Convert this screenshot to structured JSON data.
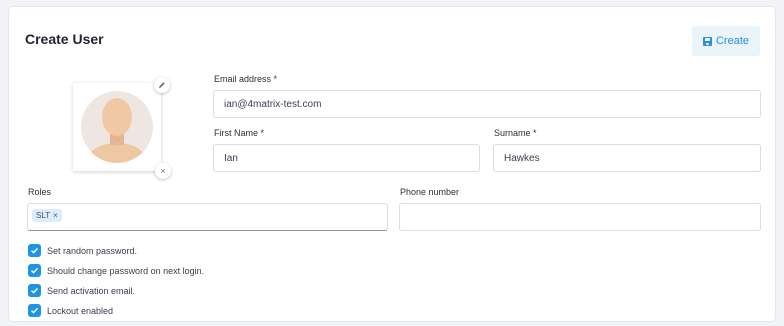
{
  "form": {
    "title": "Create User",
    "create_label": "Create",
    "email": {
      "label": "Email address *",
      "value": "ian@4matrix-test.com"
    },
    "first_name": {
      "label": "First Name *",
      "value": "Ian"
    },
    "surname": {
      "label": "Surname *",
      "value": "Hawkes"
    },
    "roles": {
      "label": "Roles",
      "chips": [
        {
          "label": "SLT",
          "remove": "×"
        }
      ]
    },
    "phone": {
      "label": "Phone number",
      "value": ""
    },
    "avatar": {
      "edit_icon": "pencil-icon",
      "remove_glyph": "×"
    },
    "options": [
      {
        "label": "Set random password.",
        "checked": true
      },
      {
        "label": "Should change password on next login.",
        "checked": true
      },
      {
        "label": "Send activation email.",
        "checked": true
      },
      {
        "label": "Lockout enabled",
        "checked": true
      }
    ]
  },
  "colors": {
    "accent": "#1e94e6",
    "button_bg": "#e9f4fb",
    "button_text": "#2d8fd8",
    "chip_bg": "#dcecf8"
  }
}
